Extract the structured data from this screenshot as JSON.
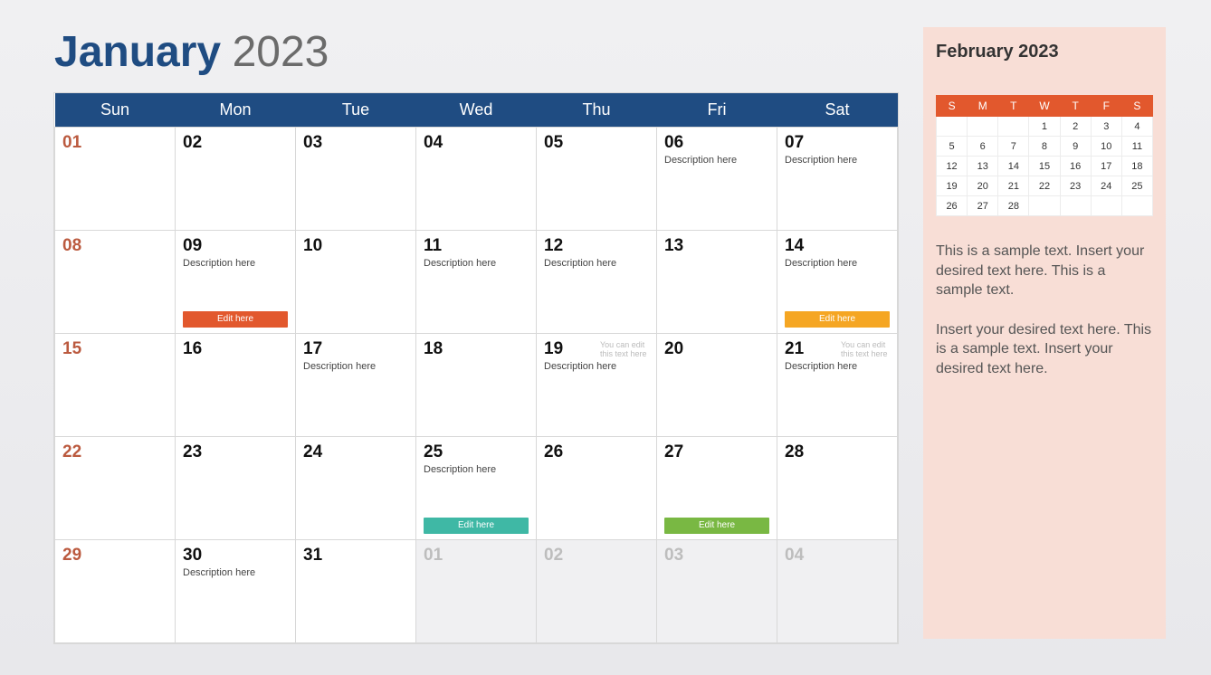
{
  "title": {
    "month": "January",
    "year": "2023"
  },
  "weekdays": [
    "Sun",
    "Mon",
    "Tue",
    "Wed",
    "Thu",
    "Fri",
    "Sat"
  ],
  "labels": {
    "desc": "Description here",
    "tip": "You can edit this text here",
    "edit": "Edit here"
  },
  "weeks": [
    [
      {
        "n": "01",
        "sun": true
      },
      {
        "n": "02"
      },
      {
        "n": "03"
      },
      {
        "n": "04"
      },
      {
        "n": "05"
      },
      {
        "n": "06",
        "desc": true
      },
      {
        "n": "07",
        "desc": true
      }
    ],
    [
      {
        "n": "08",
        "sun": true
      },
      {
        "n": "09",
        "desc": true,
        "chip": "orange"
      },
      {
        "n": "10"
      },
      {
        "n": "11",
        "desc": true
      },
      {
        "n": "12",
        "desc": true
      },
      {
        "n": "13"
      },
      {
        "n": "14",
        "desc": true,
        "chip": "amber"
      }
    ],
    [
      {
        "n": "15",
        "sun": true
      },
      {
        "n": "16"
      },
      {
        "n": "17",
        "desc": true
      },
      {
        "n": "18"
      },
      {
        "n": "19",
        "desc": true,
        "tip": true
      },
      {
        "n": "20"
      },
      {
        "n": "21",
        "desc": true,
        "tip": true
      }
    ],
    [
      {
        "n": "22",
        "sun": true
      },
      {
        "n": "23"
      },
      {
        "n": "24"
      },
      {
        "n": "25",
        "desc": true,
        "chip": "teal"
      },
      {
        "n": "26"
      },
      {
        "n": "27",
        "chip": "green"
      },
      {
        "n": "28"
      }
    ],
    [
      {
        "n": "29",
        "sun": true,
        "in": true
      },
      {
        "n": "30",
        "desc": true,
        "in": true
      },
      {
        "n": "31",
        "in": true
      },
      {
        "n": "01",
        "out": true
      },
      {
        "n": "02",
        "out": true
      },
      {
        "n": "03",
        "out": true
      },
      {
        "n": "04",
        "out": true
      }
    ]
  ],
  "mini": {
    "title": "February 2023",
    "head": [
      "S",
      "M",
      "T",
      "W",
      "T",
      "F",
      "S"
    ],
    "rows": [
      [
        "",
        "",
        "",
        "1",
        "2",
        "3",
        "4"
      ],
      [
        "5",
        "6",
        "7",
        "8",
        "9",
        "10",
        "11"
      ],
      [
        "12",
        "13",
        "14",
        "15",
        "16",
        "17",
        "18"
      ],
      [
        "19",
        "20",
        "21",
        "22",
        "23",
        "24",
        "25"
      ],
      [
        "26",
        "27",
        "28",
        "",
        "",
        "",
        ""
      ]
    ]
  },
  "side": {
    "p1": "This is a sample text. Insert your desired text here. This is a sample text.",
    "p2": "Insert your desired text here. This is a sample text. Insert your desired text here."
  }
}
